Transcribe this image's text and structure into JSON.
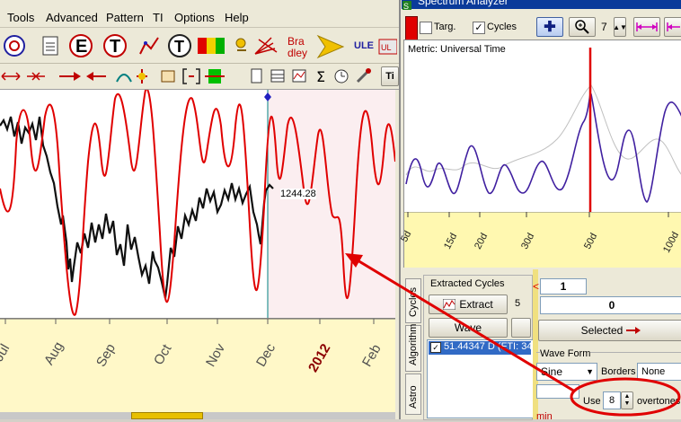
{
  "menu": {
    "items": [
      "Tools",
      "Advanced",
      "Pattern",
      "TI",
      "Options",
      "Help"
    ]
  },
  "toolbar": {
    "bradley_label": "Bra\ndley",
    "ule_label": "ULE",
    "ti_label": "Ti"
  },
  "chart": {
    "price_label": "1244.28",
    "x_labels": [
      "Jul",
      "Aug",
      "Sep",
      "Oct",
      "Nov",
      "Dec",
      "2012",
      "Feb"
    ],
    "year_color": "#8b0000"
  },
  "spectrum": {
    "window_title": "Spectrum Analyzer",
    "targ_label": "Targ.",
    "cycles_label": "Cycles",
    "zoom_value": "7",
    "metric_label": "Metric: Universal Time",
    "x_labels": [
      "5d",
      "15d",
      "20d",
      "30d",
      "50d",
      "100d"
    ],
    "extracted_cycles_label": "Extracted Cycles",
    "extract_button": "Extract",
    "extract_count": "5",
    "wave_button": "Wave",
    "cycle_item": "51.44347 D (FTI: 34",
    "from_marker": "<",
    "value1": "1",
    "value2": "0",
    "selected_button": "Selected",
    "wave_form_label": "Wave Form",
    "wave_select": "Sine",
    "borders_label": "Borders",
    "borders_select": "None",
    "use_label": "Use",
    "overtones_value": "8",
    "overtones_label": "overtones",
    "min_label": "min",
    "side_tabs": [
      "Cycles",
      "Algorithm",
      "Astro"
    ]
  },
  "colors": {
    "accent_red": "#e00000",
    "spectrum_line": "#4020a0",
    "axis_yellow": "#fff8c8"
  }
}
